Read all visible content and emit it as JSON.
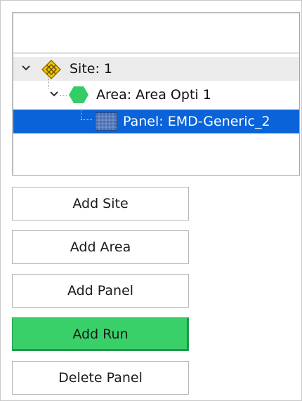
{
  "tree": {
    "site": {
      "label": "Site: 1"
    },
    "area": {
      "label": "Area: Area Opti 1"
    },
    "panel": {
      "label": "Panel: EMD-Generic_2"
    }
  },
  "buttons": {
    "add_site": "Add Site",
    "add_area": "Add Area",
    "add_panel": "Add Panel",
    "add_run": "Add Run",
    "delete_panel": "Delete Panel"
  },
  "colors": {
    "selection": "#0a63d8",
    "site_row": "#ebebeb",
    "add_run_active": "#39d06a",
    "area_icon": "#33cc66",
    "site_icon": "#f2c400"
  },
  "icons": {
    "site": "site-diamond-icon",
    "area": "area-hexagon-icon",
    "panel": "panel-grid-icon"
  }
}
